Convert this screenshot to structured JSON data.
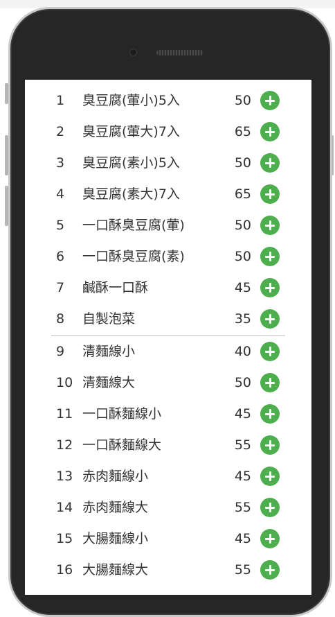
{
  "menu": {
    "group1": [
      {
        "num": "1",
        "name": "臭豆腐(葷小)5入",
        "price": "50"
      },
      {
        "num": "2",
        "name": "臭豆腐(葷大)7入",
        "price": "65"
      },
      {
        "num": "3",
        "name": "臭豆腐(素小)5入",
        "price": "50"
      },
      {
        "num": "4",
        "name": "臭豆腐(素大)7入",
        "price": "65"
      },
      {
        "num": "5",
        "name": "一口酥臭豆腐(葷)",
        "price": "50"
      },
      {
        "num": "6",
        "name": "一口酥臭豆腐(素)",
        "price": "50"
      },
      {
        "num": "7",
        "name": "鹹酥一口酥",
        "price": "45"
      },
      {
        "num": "8",
        "name": "自製泡菜",
        "price": "35"
      }
    ],
    "group2": [
      {
        "num": "9",
        "name": "清麵線小",
        "price": "40"
      },
      {
        "num": "10",
        "name": "清麵線大",
        "price": "50"
      },
      {
        "num": "11",
        "name": "一口酥麵線小",
        "price": "45"
      },
      {
        "num": "12",
        "name": "一口酥麵線大",
        "price": "55"
      },
      {
        "num": "13",
        "name": "赤肉麵線小",
        "price": "45"
      },
      {
        "num": "14",
        "name": "赤肉麵線大",
        "price": "55"
      },
      {
        "num": "15",
        "name": "大腸麵線小",
        "price": "45"
      },
      {
        "num": "16",
        "name": "大腸麵線大",
        "price": "55"
      }
    ]
  },
  "icons": {
    "add": "plus-circle-icon"
  },
  "colors": {
    "add_button": "#4cae4c",
    "device_frame": "#262626",
    "text": "#333333"
  }
}
